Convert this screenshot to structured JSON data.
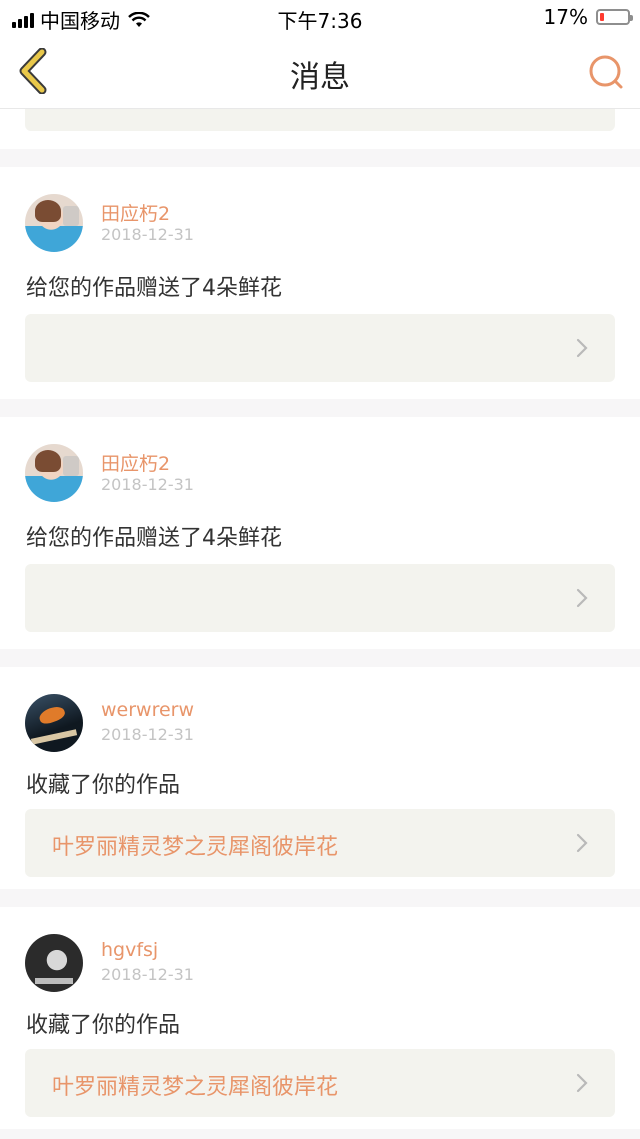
{
  "status_bar": {
    "carrier": "中国移动",
    "time": "下午7:36",
    "battery_percent": "17%",
    "battery_level": 0.17
  },
  "nav": {
    "title": "消息",
    "back_icon": "chevron-left-icon",
    "search_icon": "search-icon"
  },
  "messages": [
    {
      "username": "田应朽2",
      "date": "2018-12-31",
      "text": "给您的作品赠送了4朵鲜花",
      "work_title": "",
      "avatar": "girl-avatar"
    },
    {
      "username": "田应朽2",
      "date": "2018-12-31",
      "text": "给您的作品赠送了4朵鲜花",
      "work_title": "",
      "avatar": "girl-avatar"
    },
    {
      "username": "werwrerw",
      "date": "2018-12-31",
      "text": "收藏了你的作品",
      "work_title": "叶罗丽精灵梦之灵犀阁彼岸花",
      "avatar": "dark-avatar"
    },
    {
      "username": "hgvfsj",
      "date": "2018-12-31",
      "text": "收藏了你的作品",
      "work_title": "叶罗丽精灵梦之灵犀阁彼岸花",
      "avatar": "bw-avatar"
    }
  ],
  "colors": {
    "accent": "#e8956a",
    "back_icon": "#e9c84a",
    "work_box_bg": "#f3f3ee",
    "page_bg": "#f7f6f7"
  }
}
